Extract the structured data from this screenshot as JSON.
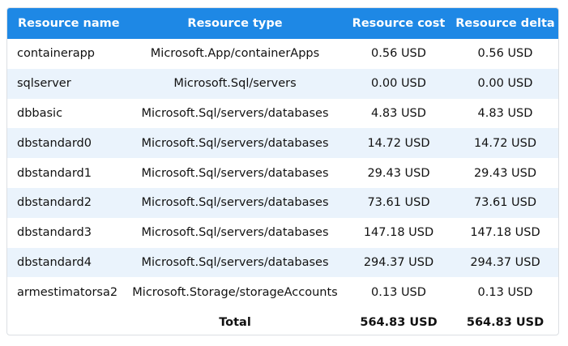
{
  "table": {
    "headers": [
      "Resource name",
      "Resource type",
      "Resource cost",
      "Resource delta"
    ],
    "rows": [
      {
        "name": "containerapp",
        "type": "Microsoft.App/containerApps",
        "cost": "0.56 USD",
        "delta": "0.56 USD"
      },
      {
        "name": "sqlserver",
        "type": "Microsoft.Sql/servers",
        "cost": "0.00 USD",
        "delta": "0.00 USD"
      },
      {
        "name": "dbbasic",
        "type": "Microsoft.Sql/servers/databases",
        "cost": "4.83 USD",
        "delta": "4.83 USD"
      },
      {
        "name": "dbstandard0",
        "type": "Microsoft.Sql/servers/databases",
        "cost": "14.72 USD",
        "delta": "14.72 USD"
      },
      {
        "name": "dbstandard1",
        "type": "Microsoft.Sql/servers/databases",
        "cost": "29.43 USD",
        "delta": "29.43 USD"
      },
      {
        "name": "dbstandard2",
        "type": "Microsoft.Sql/servers/databases",
        "cost": "73.61 USD",
        "delta": "73.61 USD"
      },
      {
        "name": "dbstandard3",
        "type": "Microsoft.Sql/servers/databases",
        "cost": "147.18 USD",
        "delta": "147.18 USD"
      },
      {
        "name": "dbstandard4",
        "type": "Microsoft.Sql/servers/databases",
        "cost": "294.37 USD",
        "delta": "294.37 USD"
      },
      {
        "name": "armestimatorsa2",
        "type": "Microsoft.Storage/storageAccounts",
        "cost": "0.13 USD",
        "delta": "0.13 USD"
      }
    ],
    "total": {
      "label": "Total",
      "cost": "564.83 USD",
      "delta": "564.83 USD"
    }
  },
  "colors": {
    "header_bg": "#1e88e5",
    "header_text": "#ffffff",
    "alt_row_bg": "#eaf3fc",
    "row_bg": "#ffffff",
    "border": "#dcdfe3"
  }
}
